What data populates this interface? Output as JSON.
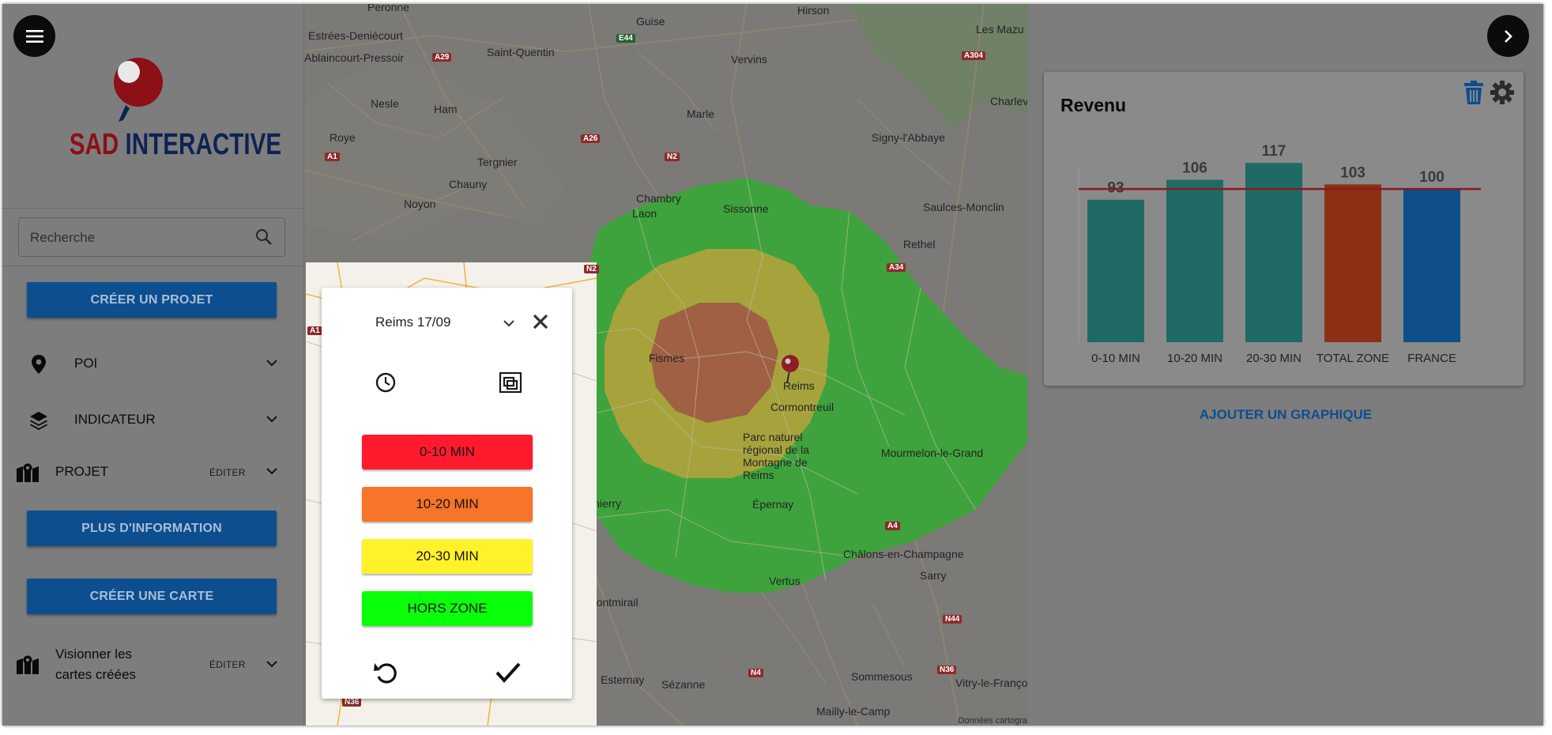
{
  "app": {
    "brand_part1": "SAD",
    "brand_part2": "INTERACTIVE"
  },
  "sidebar": {
    "search_placeholder": "Recherche",
    "create_project": "CRÉER UN PROJET",
    "nav": [
      {
        "label": "POI",
        "icon": "map-pin-icon"
      },
      {
        "label": "INDICATEUR",
        "icon": "layers-icon"
      },
      {
        "label": "PROJET",
        "edit": "ÉDITER",
        "icon": "folded-map-icon"
      }
    ],
    "more_info": "PLUS D'INFORMATION",
    "create_map": "CRÉER UNE CARTE",
    "view_maps_line1": "Visionner les",
    "view_maps_line2": "cartes créées",
    "view_maps_edit": "ÉDITER"
  },
  "map": {
    "places": [
      "Péronne",
      "Guise",
      "Hirson",
      "Les Mazu",
      "Estrées-Deniécourt",
      "Saint-Quentin",
      "Ablaincourt-Pressoir",
      "Vervins",
      "Charlev",
      "Nesle",
      "Ham",
      "Marle",
      "Roye",
      "Signy-l'Abbaye",
      "Tergnier",
      "Chauny",
      "Chambry",
      "Laon",
      "Noyon",
      "Sissonne",
      "Saulces-Monclin",
      "Rethel",
      "Fismes",
      "Reims",
      "Cormontreuil",
      "Parc naturel régional de la Montagne de Reims",
      "Épernay",
      "Mourmelon-le-Grand",
      "Château-Thierry",
      "Châlons-en-Champagne",
      "Sarry",
      "Vertus",
      "Montmirail",
      "Esternay",
      "Sézanne",
      "Sommesous",
      "Vitry-le-François",
      "Mailly-le-Camp"
    ],
    "roads": [
      "A29",
      "E44",
      "A304",
      "A26",
      "N2",
      "A1",
      "A34",
      "A4",
      "N44",
      "N4",
      "N36"
    ],
    "attribution": "Données cartogra"
  },
  "popup": {
    "title": "Reims 17/09",
    "bands": [
      {
        "label": "0-10 MIN",
        "color": "#ff1a2e"
      },
      {
        "label": "10-20 MIN",
        "color": "#f77428"
      },
      {
        "label": "20-30 MIN",
        "color": "#fff22a"
      },
      {
        "label": "HORS ZONE",
        "color": "#0aff0a"
      }
    ]
  },
  "panel": {
    "card_title": "Revenu",
    "add_chart": "AJOUTER UN GRAPHIQUE"
  },
  "chart_data": {
    "type": "bar",
    "categories": [
      "0-10 MIN",
      "10-20 MIN",
      "20-30 MIN",
      "TOTAL ZONE",
      "FRANCE"
    ],
    "values": [
      93,
      106,
      117,
      103,
      100
    ],
    "colors": [
      "#206a65",
      "#206a65",
      "#206a65",
      "#8d3016",
      "#0e4e8a"
    ],
    "reference_line": 100,
    "reference_color": "#8a1a22",
    "ylim": [
      0,
      130
    ]
  }
}
